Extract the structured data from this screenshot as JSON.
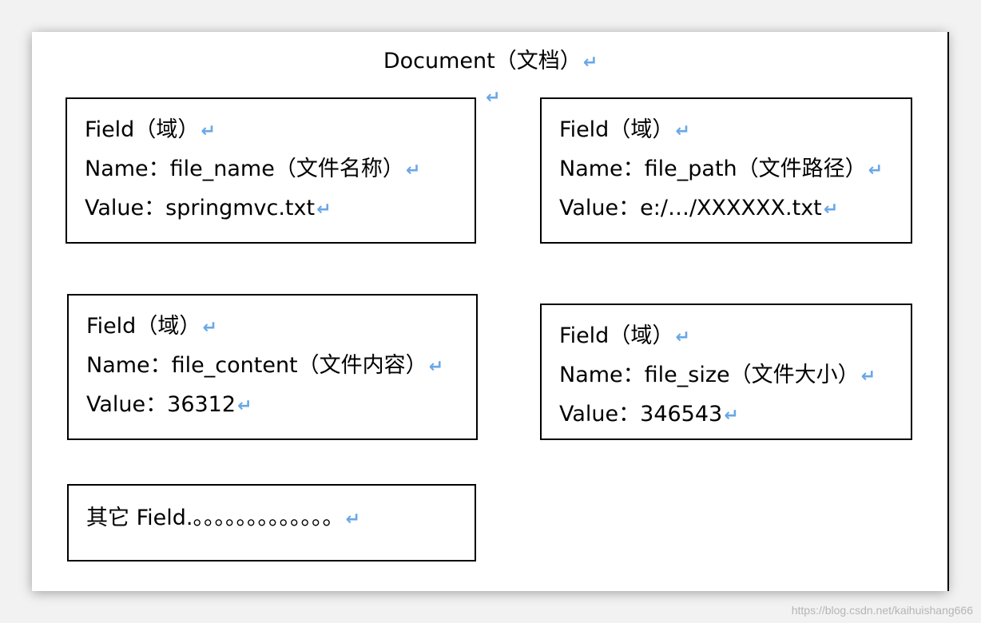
{
  "document": {
    "title": "Document（文档）",
    "return_mark": "↵"
  },
  "fields": [
    {
      "heading": "Field（域）",
      "name_line": "Name：file_name（文件名称）",
      "value_line": "Value：springmvc.txt"
    },
    {
      "heading": "Field（域）",
      "name_line": "Name：file_path（文件路径）",
      "value_line": "Value：e:/…/XXXXXX.txt"
    },
    {
      "heading": "Field（域）",
      "name_line": "Name：file_content（文件内容）",
      "value_line": "Value：36312"
    },
    {
      "heading": "Field（域）",
      "name_line": "Name：file_size（文件大小）",
      "value_line": "Value：346543"
    }
  ],
  "other_fields": "其它 Field.。。。。。。。。。。。。。",
  "watermark": "https://blog.csdn.net/kaihuishang666",
  "colors": {
    "return_mark": "#6aa7e6",
    "border": "#000000",
    "page": "#ffffff"
  }
}
